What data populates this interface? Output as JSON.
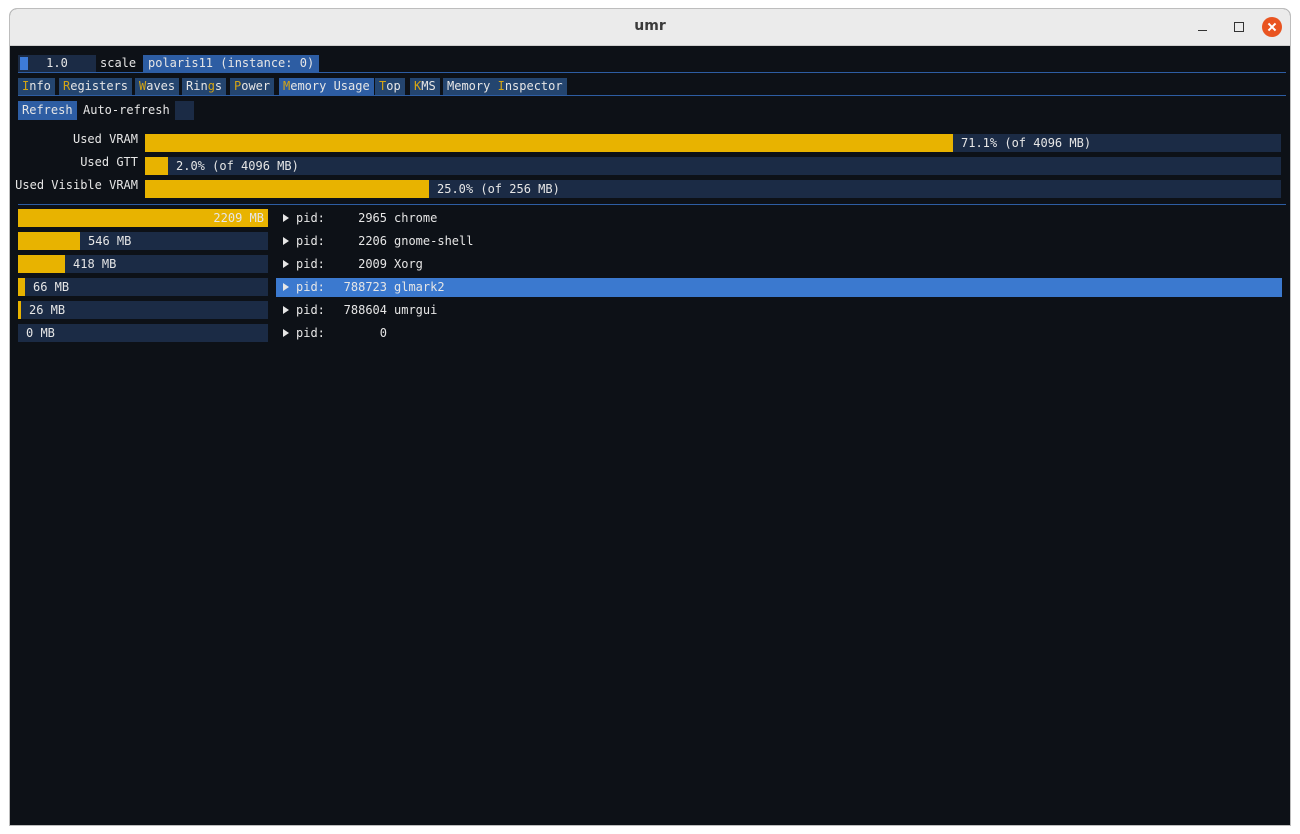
{
  "window": {
    "title": "umr"
  },
  "toolbar": {
    "scale_value": "1.0",
    "scale_label": "scale",
    "device_tab": "polaris11 (instance: 0)"
  },
  "tabs": [
    {
      "hk": "I",
      "rest": "nfo"
    },
    {
      "hk": "R",
      "rest": "egisters"
    },
    {
      "hk": "W",
      "rest": "aves"
    },
    {
      "pre": "Rin",
      "hk": "g",
      "rest": "s"
    },
    {
      "hk": "P",
      "rest": "ower"
    },
    {
      "hk": "M",
      "rest": "emory Usage"
    },
    {
      "hk": "T",
      "rest": "op"
    },
    {
      "hk": "K",
      "rest": "MS"
    },
    {
      "pre": "Memory ",
      "hk": "I",
      "rest": "nspector"
    }
  ],
  "active_tab": "Memory Usage",
  "controls": {
    "refresh_label": "Refresh",
    "auto_refresh_label": "Auto-refresh",
    "auto_refresh_checked": false
  },
  "memory": [
    {
      "label": "Used VRAM",
      "text": "71.1% (of 4096 MB)",
      "fraction": 0.711
    },
    {
      "label": "Used GTT",
      "text": "2.0% (of 4096 MB)",
      "fraction": 0.02
    },
    {
      "label": "Used Visible VRAM",
      "text": "25.0% (of 256 MB)",
      "fraction": 0.25
    }
  ],
  "processes": [
    {
      "usage_text": "2209 MB",
      "usage_mb": 2209,
      "pid_label": "pid:",
      "pid": "2965",
      "name": "chrome",
      "selected": false
    },
    {
      "usage_text": "546 MB",
      "usage_mb": 546,
      "pid_label": "pid:",
      "pid": "2206",
      "name": "gnome-shell",
      "selected": false
    },
    {
      "usage_text": "418 MB",
      "usage_mb": 418,
      "pid_label": "pid:",
      "pid": "2009",
      "name": "Xorg",
      "selected": false
    },
    {
      "usage_text": "66 MB",
      "usage_mb": 66,
      "pid_label": "pid:",
      "pid": "788723",
      "name": "glmark2",
      "selected": true
    },
    {
      "usage_text": "26 MB",
      "usage_mb": 26,
      "pid_label": "pid:",
      "pid": "788604",
      "name": "umrgui",
      "selected": false
    },
    {
      "usage_text": "0 MB",
      "usage_mb": 0,
      "pid_label": "pid:",
      "pid": "0",
      "name": "",
      "selected": false
    }
  ],
  "colors": {
    "bar_fill": "#e8b300",
    "frame_bg": "#1b2b45",
    "selected_row": "#3b79cf",
    "tab_bg": "#24456f",
    "hotkey": "#d4a514",
    "close_button": "#e95420"
  }
}
